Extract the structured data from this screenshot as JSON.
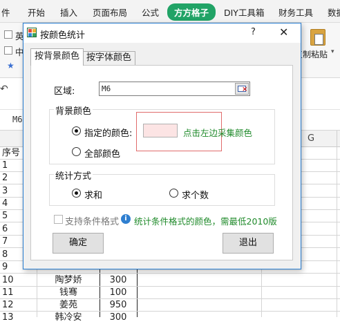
{
  "ribbon": {
    "tabs": [
      "件",
      "开始",
      "插入",
      "页面布局",
      "公式",
      "方方格子",
      "DIY工具箱",
      "财务工具",
      "数据"
    ],
    "active_tab": "方方格子",
    "body_texts": [
      "英",
      "中"
    ],
    "paste_label": "复制粘贴",
    "accent_color": "#21a366"
  },
  "spreadsheet": {
    "name_box": "M6",
    "column_header": "G",
    "header_row": {
      "num": "序号"
    },
    "rows": [
      {
        "num": "1",
        "name": "",
        "value": ""
      },
      {
        "num": "2",
        "name": "",
        "value": ""
      },
      {
        "num": "3",
        "name": "",
        "value": ""
      },
      {
        "num": "4",
        "name": "",
        "value": ""
      },
      {
        "num": "5",
        "name": "",
        "value": ""
      },
      {
        "num": "6",
        "name": "",
        "value": ""
      },
      {
        "num": "7",
        "name": "",
        "value": ""
      },
      {
        "num": "8",
        "name": "",
        "value": ""
      },
      {
        "num": "9",
        "name": "",
        "value": ""
      },
      {
        "num": "10",
        "name": "陶梦娇",
        "value": "300"
      },
      {
        "num": "11",
        "name": "钱骞",
        "value": "100"
      },
      {
        "num": "12",
        "name": "姜苑",
        "value": "950"
      },
      {
        "num": "13",
        "name": "韩冷安",
        "value": "300"
      }
    ]
  },
  "dialog": {
    "title": "按颜色统计",
    "help": "?",
    "close": "✕",
    "tabs": [
      "按背景颜色",
      "按字体颜色"
    ],
    "selected_tab": "按背景颜色",
    "region_label": "区域:",
    "region_value": "M6",
    "bg_group": {
      "title": "背景颜色",
      "option_specified": "指定的颜色:",
      "option_all": "全部颜色",
      "selected": "指定的颜色:",
      "swatch_color": "#fce4e4",
      "hint": "点击左边采集颜色"
    },
    "stat_group": {
      "title": "统计方式",
      "option_sum": "求和",
      "option_count": "求个数",
      "selected": "求和"
    },
    "conditional_format": {
      "label": "支持条件格式",
      "checked": false,
      "note": "统计条件格式的颜色，需最低2010版"
    },
    "ok_button": "确定",
    "exit_button": "退出"
  }
}
